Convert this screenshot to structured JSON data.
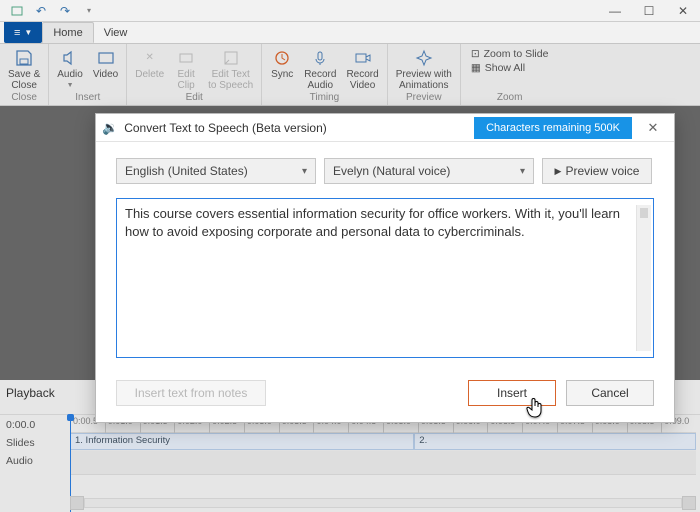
{
  "titlebar": {
    "undo": "↶",
    "redo": "↷"
  },
  "tabs": {
    "file": "≡",
    "home": "Home",
    "view": "View"
  },
  "ribbon": {
    "close": {
      "save_close": "Save &\nClose",
      "label": "Close"
    },
    "insert": {
      "audio": "Audio",
      "video": "Video",
      "label": "Insert"
    },
    "edit": {
      "delete": "Delete",
      "edit_clip": "Edit\nClip",
      "edit_tts": "Edit Text\nto Speech",
      "label": "Edit"
    },
    "timing": {
      "sync": "Sync",
      "rec_audio": "Record\nAudio",
      "rec_video": "Record\nVideo",
      "label": "Timing"
    },
    "preview": {
      "preview_anim": "Preview with\nAnimations",
      "label": "Preview"
    },
    "zoom": {
      "zoom_slide": "Zoom to Slide",
      "show_all": "Show All",
      "label": "Zoom"
    }
  },
  "playback": {
    "label": "Playback",
    "rows": {
      "time": "0:00.0",
      "slides": "Slides",
      "audio": "Audio"
    },
    "ticks": [
      "0:00.5",
      "0:01.0",
      "0:01.5",
      "0:02.0",
      "0:02.5",
      "0:03.0",
      "0:03.5",
      "0:04.0",
      "0:04.5",
      "0:05.0",
      "0:05.5",
      "0:06.0",
      "0:06.5",
      "0:07.0",
      "0:07.5",
      "0:08.0",
      "0:08.5",
      "0:09.0"
    ],
    "slides": {
      "s1": "1. Information Security",
      "s2": "2."
    }
  },
  "dialog": {
    "icon": "tts-icon",
    "title": "Convert Text to Speech (Beta version)",
    "badge": "Characters remaining 500K",
    "language": "English (United States)",
    "voice": "Evelyn (Natural voice)",
    "preview_voice": "Preview voice",
    "text": "This course covers essential information security for office workers. With it, you'll learn how to avoid exposing corporate and personal data to cybercriminals.",
    "insert_notes": "Insert text from notes",
    "insert": "Insert",
    "cancel": "Cancel"
  }
}
